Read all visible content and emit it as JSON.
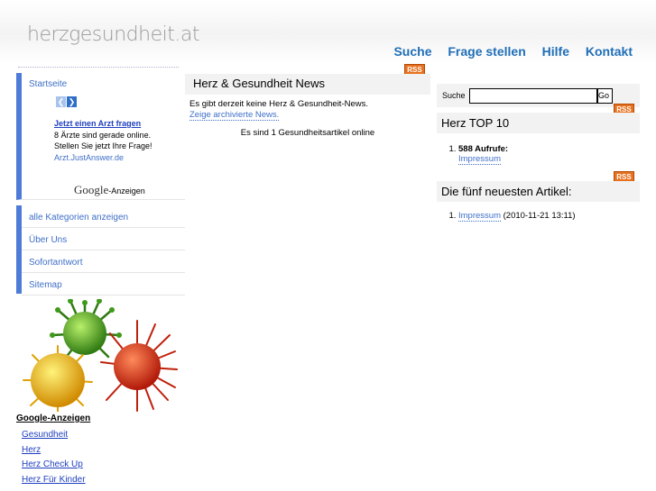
{
  "site": {
    "logo": "herzgesundheit.at"
  },
  "topnav": [
    {
      "label": "Suche"
    },
    {
      "label": "Frage stellen"
    },
    {
      "label": "Hilfe"
    },
    {
      "label": "Kontakt"
    }
  ],
  "sidebar": {
    "start": "Startseite",
    "ad": {
      "title": "Jetzt einen Arzt fragen",
      "body": "8 Ärzte sind gerade online. Stellen Sie jetzt Ihre Frage!",
      "url": "Arzt.JustAnswer.de"
    },
    "google_word": "Google",
    "google_suffix": "-Anzeigen",
    "menu": [
      {
        "label": "alle Kategorien anzeigen"
      },
      {
        "label": "Über Uns"
      },
      {
        "label": "Sofortantwort"
      },
      {
        "label": "Sitemap"
      }
    ]
  },
  "ads_block": {
    "heading": "Google-Anzeigen",
    "links": [
      "Gesundheit",
      "Herz",
      "Herz Check Up",
      "Herz Für Kinder"
    ]
  },
  "center": {
    "rss": "RSS",
    "title": "Herz & Gesundheit News",
    "no_news": "Es gibt derzeit keine Herz & Gesundheit-News.",
    "archive_link": "Zeige archivierte News.",
    "count_text": "Es sind 1 Gesundheitsartikel online"
  },
  "right": {
    "search_label": "Suche",
    "search_value": "",
    "go": "Go",
    "rss": "RSS",
    "top_title": "Herz TOP 10",
    "top_items": [
      {
        "views": "588 Aufrufe:",
        "link": "Impressum"
      }
    ],
    "newest_title": "Die fünf neuesten Artikel:",
    "newest_items": [
      {
        "link": "Impressum",
        "date": "(2010-11-21 13:11)"
      }
    ]
  },
  "colors": {
    "accent": "#4f7bd8",
    "link": "#3f6fc8",
    "nav": "#1f6eb8",
    "rss": "#e8711f"
  }
}
